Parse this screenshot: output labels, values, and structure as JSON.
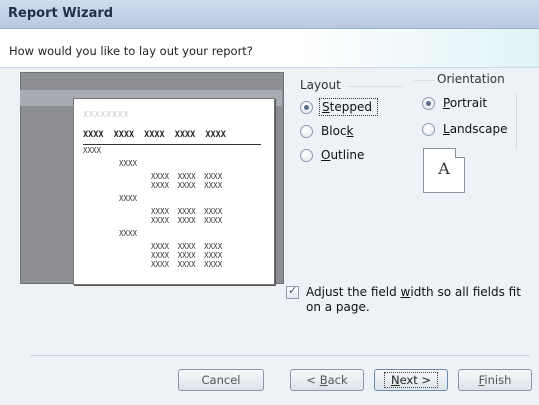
{
  "window": {
    "title": "Report Wizard"
  },
  "prompt": "How would you like to lay out your report?",
  "preview": {
    "title_placeholder": "XXXXXXXX",
    "header_row": "XXXX XXXX XXXX XXXX XXXX",
    "rows": [
      "XXXX",
      "XXXX",
      "XXXX XXXX XXXX",
      "XXXX XXXX XXXX",
      "XXXX",
      "XXXX XXXX XXXX",
      "XXXX XXXX XXXX",
      "XXXX",
      "XXXX XXXX XXXX",
      "XXXX XXXX XXXX",
      "XXXX XXXX XXXX"
    ]
  },
  "layout": {
    "label": "Layout",
    "selected": "Stepped",
    "options": [
      {
        "pre": "",
        "u": "S",
        "post": "tepped",
        "checked": true
      },
      {
        "pre": "Bloc",
        "u": "k",
        "post": "",
        "checked": false
      },
      {
        "pre": "",
        "u": "O",
        "post": "utline",
        "checked": false
      }
    ]
  },
  "orientation": {
    "label": "Orientation",
    "selected": "Portrait",
    "options": [
      {
        "pre": "",
        "u": "P",
        "post": "ortrait",
        "checked": true
      },
      {
        "pre": "",
        "u": "L",
        "post": "andscape",
        "checked": false
      }
    ],
    "page_icon_letter": "A"
  },
  "adjust_width": {
    "checked": true,
    "pre": "Adjust the field ",
    "u": "w",
    "post": "idth so all fields fit on a page."
  },
  "buttons": {
    "cancel": "Cancel",
    "back": {
      "pre": "< ",
      "u": "B",
      "post": "ack"
    },
    "next": {
      "u": "N",
      "post": "ext >"
    },
    "finish": {
      "u": "F",
      "post": "inish"
    }
  }
}
